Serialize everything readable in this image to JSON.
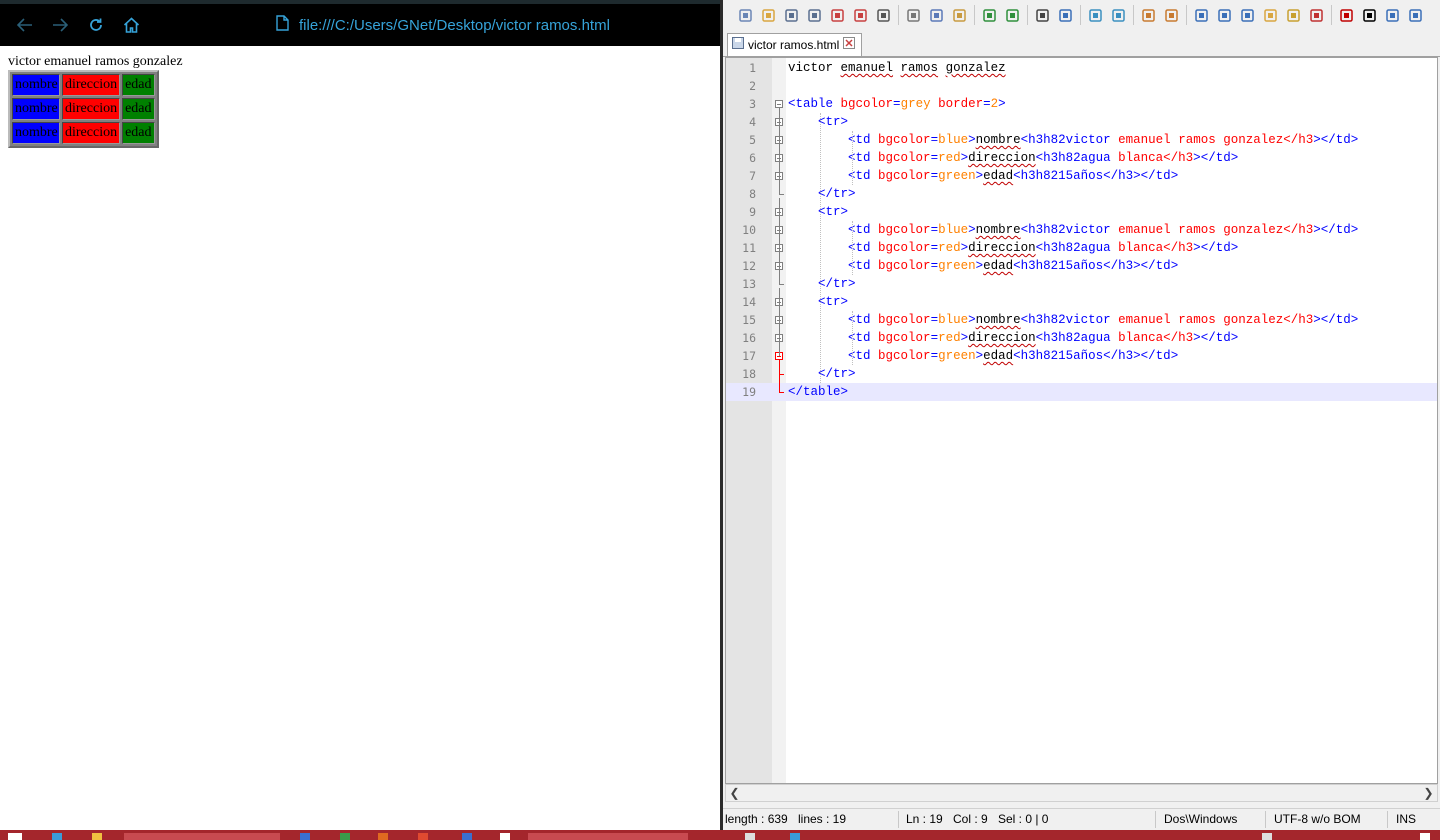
{
  "browser": {
    "url": "file:///C:/Users/GNet/Desktop/victor ramos.html",
    "page": {
      "heading": "victor emanuel ramos gonzalez",
      "table": {
        "rows": [
          [
            "nombre",
            "direccion",
            "edad"
          ],
          [
            "nombre",
            "direccion",
            "edad"
          ],
          [
            "nombre",
            "direccion",
            "edad"
          ]
        ]
      }
    }
  },
  "editor": {
    "tab_label": "victor ramos.html",
    "lines": [
      {
        "num": "1",
        "text": "victor emanuel ramos gonzalez"
      },
      {
        "num": "2",
        "text": ""
      },
      {
        "num": "3",
        "text": "<table bgcolor=grey border=2>"
      },
      {
        "num": "4",
        "text": "    <tr>"
      },
      {
        "num": "5",
        "text": "        <td bgcolor=blue>nombre<h3h82victor emanuel ramos gonzalez</h3></td>"
      },
      {
        "num": "6",
        "text": "        <td bgcolor=red>direccion<h3h82agua blanca</h3></td>"
      },
      {
        "num": "7",
        "text": "        <td bgcolor=green>edad<h3h8215años</h3></td>"
      },
      {
        "num": "8",
        "text": "    </tr>"
      },
      {
        "num": "9",
        "text": "    <tr>"
      },
      {
        "num": "10",
        "text": "        <td bgcolor=blue>nombre<h3h82victor emanuel ramos gonzalez</h3></td>"
      },
      {
        "num": "11",
        "text": "        <td bgcolor=red>direccion<h3h82agua blanca</h3></td>"
      },
      {
        "num": "12",
        "text": "        <td bgcolor=green>edad<h3h8215años</h3></td>"
      },
      {
        "num": "13",
        "text": "    </tr>"
      },
      {
        "num": "14",
        "text": "    <tr>"
      },
      {
        "num": "15",
        "text": "        <td bgcolor=blue>nombre<h3h82victor emanuel ramos gonzalez</h3></td>"
      },
      {
        "num": "16",
        "text": "        <td bgcolor=red>direccion<h3h82agua blanca</h3></td>"
      },
      {
        "num": "17",
        "text": "        <td bgcolor=green>edad<h3h8215años</h3></td>"
      },
      {
        "num": "18",
        "text": "    </tr>"
      },
      {
        "num": "19",
        "text": "</table>"
      }
    ],
    "current_line": 19,
    "status": {
      "length": "length : 639",
      "lines": "lines : 19",
      "ln": "Ln : 19",
      "col": "Col : 9",
      "sel": "Sel : 0 | 0",
      "eol": "Dos\\Windows",
      "encoding": "UTF-8 w/o BOM",
      "mode": "INS"
    }
  },
  "colors": {
    "browser_bar": "#000000",
    "url_accent": "#36a3d9",
    "cell_blue": "#0000ff",
    "cell_red": "#ff0000",
    "cell_green": "#008000",
    "taskbar": "#a4262c"
  },
  "icons": {
    "browser": [
      "back-arrow-icon",
      "forward-arrow-icon",
      "reload-icon",
      "home-icon",
      "file-icon"
    ],
    "toolbar": [
      "new-file-icon",
      "open-file-icon",
      "save-icon",
      "save-all-icon",
      "close-icon",
      "close-all-icon",
      "print-icon",
      "cut-icon",
      "copy-icon",
      "paste-icon",
      "undo-icon",
      "redo-icon",
      "find-icon",
      "replace-icon",
      "zoom-in-icon",
      "zoom-out-icon",
      "sync-vertical-icon",
      "sync-horizontal-icon",
      "word-wrap-icon",
      "show-all-characters-icon",
      "indent-guide-icon",
      "user-language-icon",
      "doc-map-icon",
      "function-list-icon",
      "record-macro-icon",
      "stop-macro-icon",
      "play-macro-icon",
      "run-macro-multiple-icon"
    ]
  }
}
